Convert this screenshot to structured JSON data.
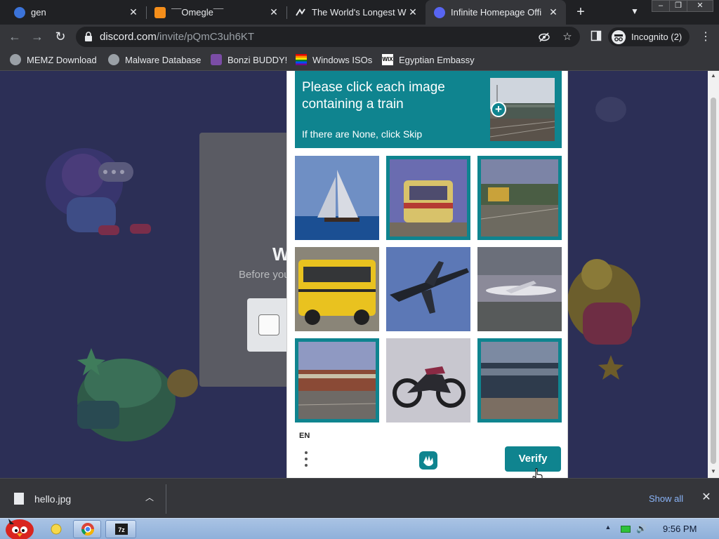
{
  "browser": {
    "tabs": [
      {
        "title": "gen",
        "favicon": "gen-icon",
        "color": "#3b73d9"
      },
      {
        "title": "¯¯Omegle¯¯",
        "favicon": "omegle-icon",
        "color": "#f58e1a"
      },
      {
        "title": "The World's Longest W",
        "favicon": "link-icon",
        "color": "#9aa0a6"
      },
      {
        "title": "Infinite Homepage Offi",
        "favicon": "discord-icon",
        "color": "#5865f2"
      }
    ],
    "url_host": "discord.com",
    "url_path": "/invite/pQmC3uh6KT",
    "profile_label": "Incognito (2)",
    "bookmarks": [
      {
        "label": "MEMZ Download"
      },
      {
        "label": "Malware Database"
      },
      {
        "label": "Bonzi BUDDY!"
      },
      {
        "label": "Windows ISOs"
      },
      {
        "label": "Egyptian Embassy"
      }
    ]
  },
  "background_page": {
    "heading_fragment": "W",
    "subtitle_fragment": "Before you"
  },
  "captcha": {
    "prompt": "Please click each image containing a train",
    "hint": "If there are None, click Skip",
    "images": [
      {
        "subject": "sailboat",
        "selected": false
      },
      {
        "subject": "train",
        "selected": true
      },
      {
        "subject": "train",
        "selected": true
      },
      {
        "subject": "school-bus",
        "selected": false
      },
      {
        "subject": "airplane",
        "selected": false
      },
      {
        "subject": "airplane",
        "selected": false
      },
      {
        "subject": "train",
        "selected": true
      },
      {
        "subject": "motorcycle",
        "selected": false
      },
      {
        "subject": "train",
        "selected": true
      }
    ],
    "language": "EN",
    "verify_label": "Verify",
    "accent_color": "#0f848f"
  },
  "downloads": {
    "file_name": "hello.jpg",
    "show_all_label": "Show all"
  },
  "taskbar": {
    "clock": "9:56 PM"
  }
}
